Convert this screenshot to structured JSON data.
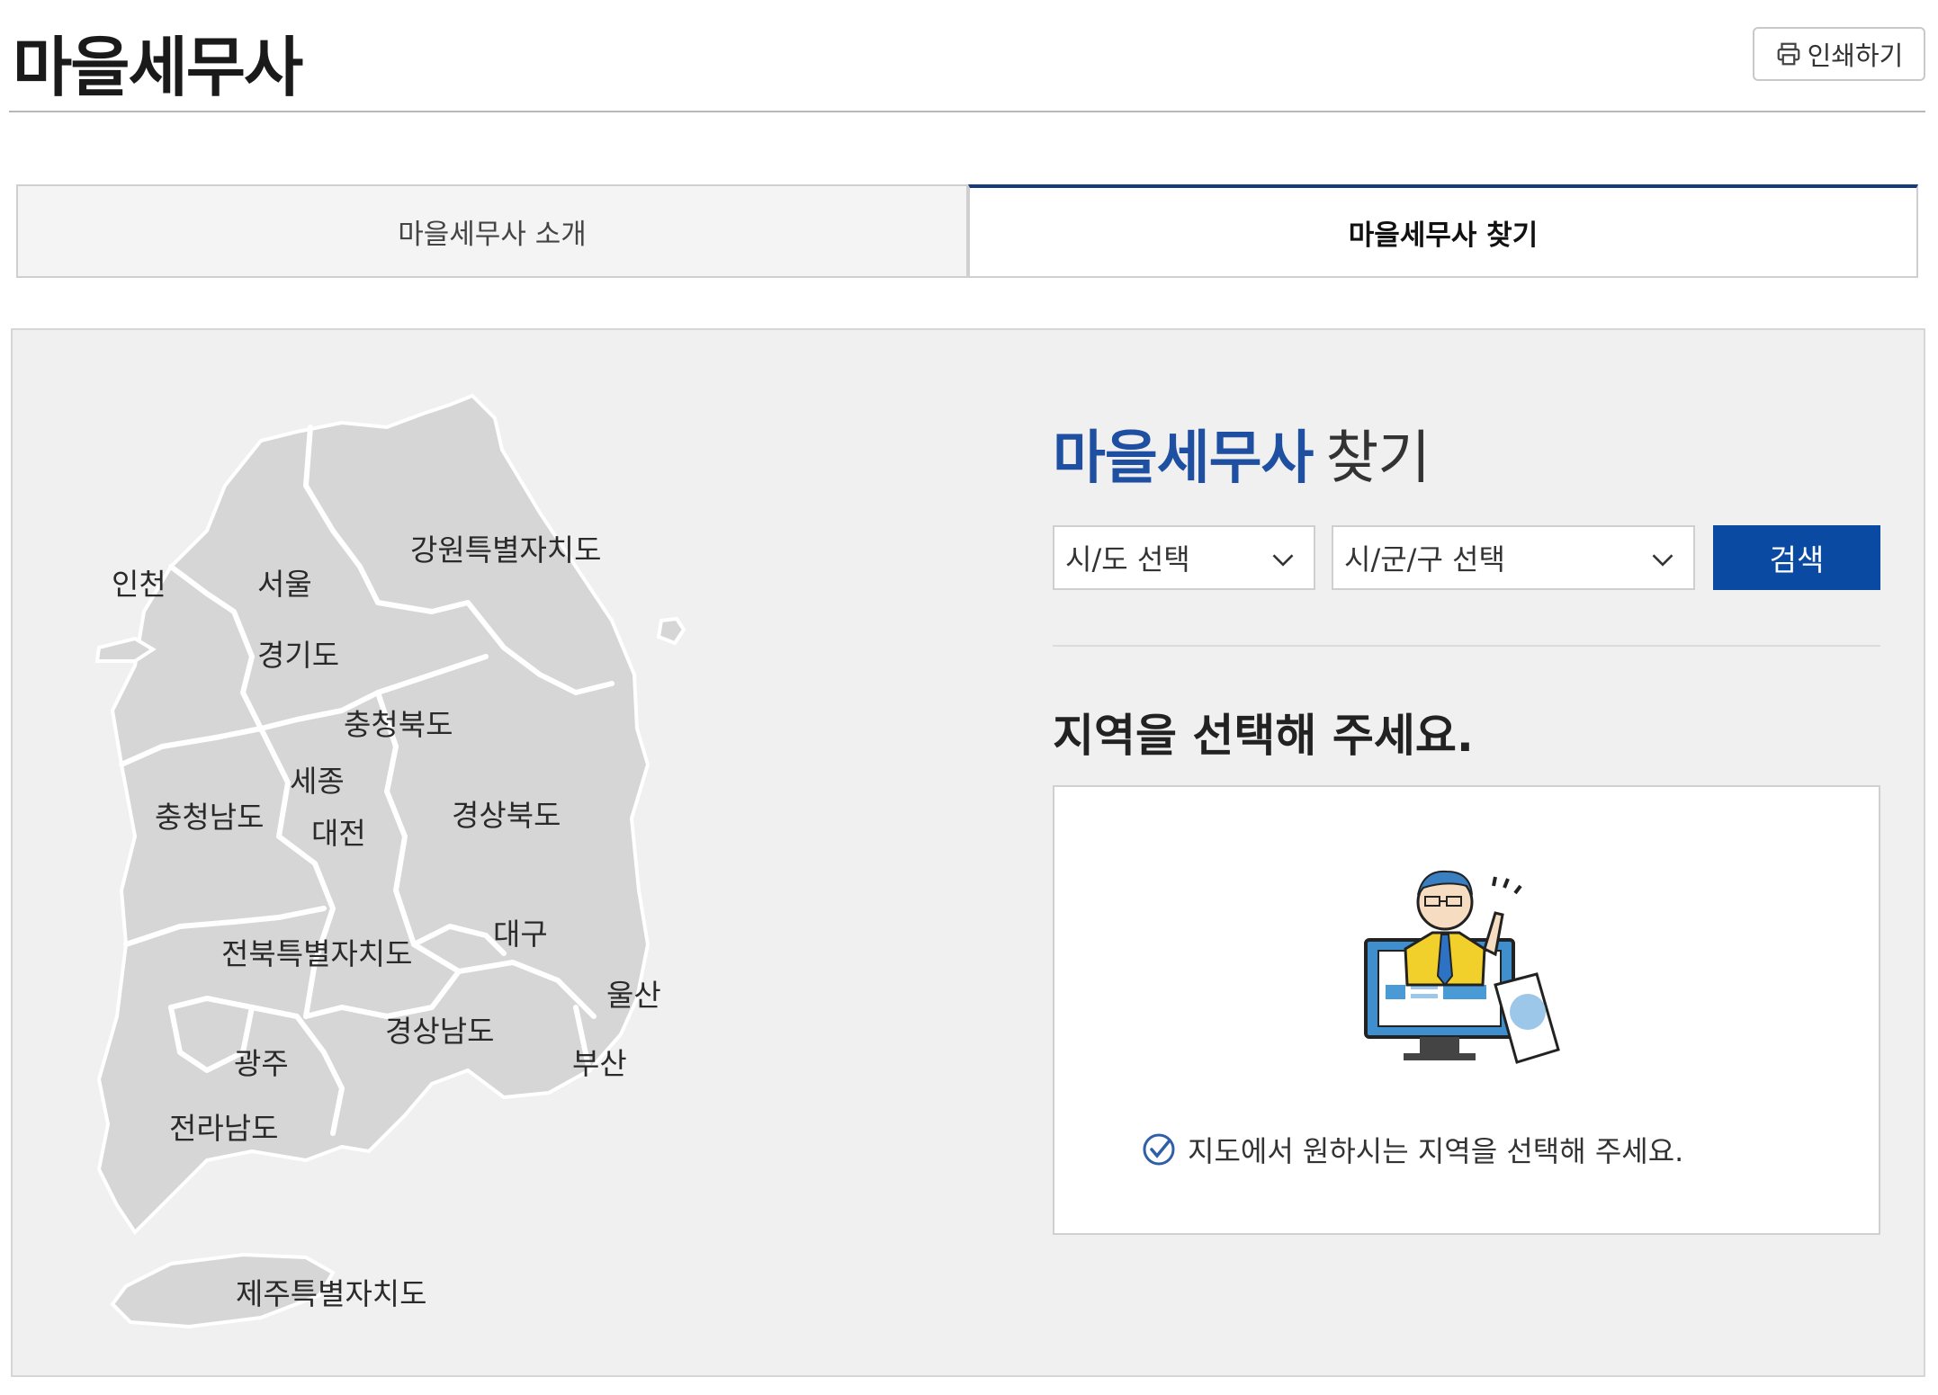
{
  "page": {
    "title": "마을세무사",
    "print_label": "인쇄하기"
  },
  "tabs": [
    {
      "label": "마을세무사 소개",
      "active": false
    },
    {
      "label": "마을세무사 찾기",
      "active": true
    }
  ],
  "map": {
    "regions": [
      "인천",
      "서울",
      "강원특별자치도",
      "경기도",
      "충청북도",
      "세종",
      "충청남도",
      "대전",
      "경상북도",
      "대구",
      "전북특별자치도",
      "울산",
      "경상남도",
      "광주",
      "부산",
      "전라남도",
      "제주특별자치도"
    ]
  },
  "search": {
    "title_highlight": "마을세무사",
    "title_rest": "찾기",
    "sido_placeholder": "시/도 선택",
    "gungu_placeholder": "시/군/구 선택",
    "button_label": "검색"
  },
  "result": {
    "prompt": "지역을 선택해 주세요.",
    "note": "지도에서 원하시는 지역을 선택해 주세요."
  },
  "colors": {
    "accent": "#0b4aa2",
    "title_blue": "#1e4fa0",
    "tab_border": "#173a7a",
    "map_fill": "#d6d6d6",
    "panel_bg": "#f0f0f0"
  }
}
